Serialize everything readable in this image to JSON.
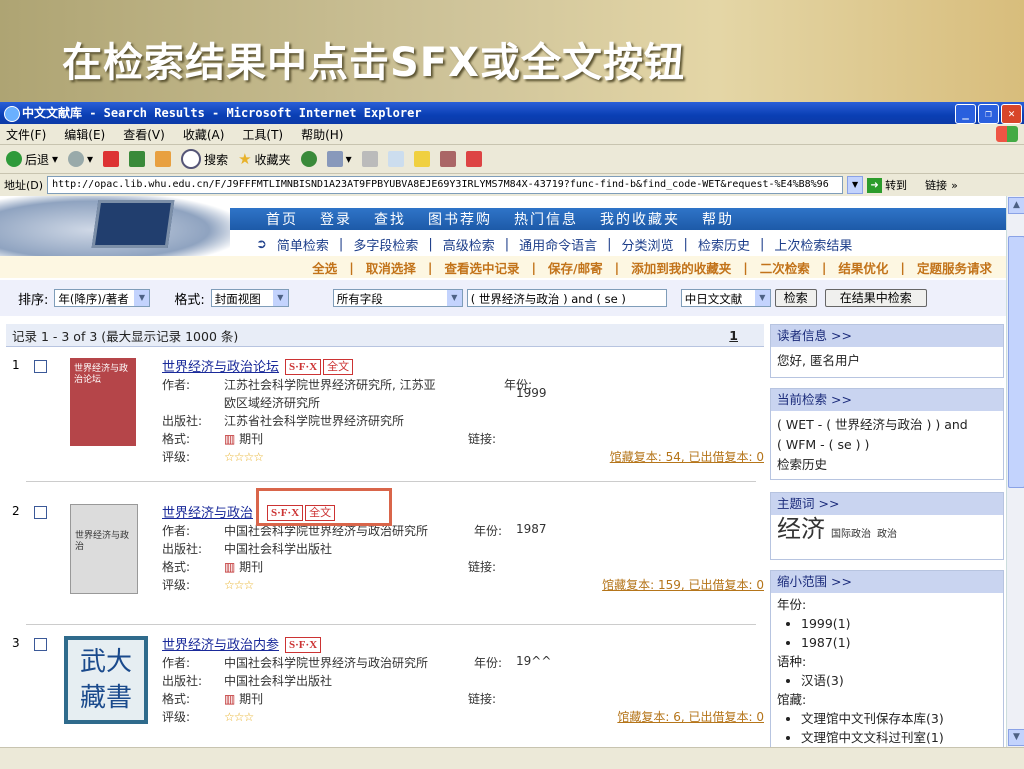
{
  "slide": {
    "title": "在检索结果中点击SFX或全文按钮"
  },
  "window": {
    "title": "中文文献库 - Search Results - Microsoft Internet Explorer",
    "menu": [
      "文件(F)",
      "编辑(E)",
      "查看(V)",
      "收藏(A)",
      "工具(T)",
      "帮助(H)"
    ],
    "toolbar": {
      "back": "后退",
      "search": "搜索",
      "favorites": "收藏夹"
    },
    "address_label": "地址(D)",
    "address": "http://opac.lib.whu.edu.cn/F/J9FFFMTLIMNBISND1A23AT9FPBYUBVA8EJE69Y3IRLYMS7M84X-43719?func-find-b&find_code-WET&request-%E4%B8%96",
    "go": "转到",
    "links": "链接"
  },
  "nav": {
    "top": [
      "首页",
      "登录",
      "查找",
      "图书荐购",
      "热门信息",
      "我的收藏夹",
      "帮助"
    ],
    "sub": [
      "简单检索",
      "多字段检索",
      "高级检索",
      "通用命令语言",
      "分类浏览",
      "检索历史",
      "上次检索结果"
    ]
  },
  "actions": [
    "全选",
    "取消选择",
    "查看选中记录",
    "保存/邮寄",
    "添加到我的收藏夹",
    "二次检索",
    "结果优化",
    "定题服务请求"
  ],
  "search": {
    "sort_label": "排序:",
    "sort_value": "年(降序)/著者",
    "format_label": "格式:",
    "format_value": "封面视图",
    "field_value": "所有字段",
    "query_value": "( 世界经济与政治 ) and ( se )",
    "db_value": "中日文文献",
    "search_btn": "检索",
    "refine_btn": "在结果中检索"
  },
  "results": {
    "header": "记录 1 - 3 of 3 (最大显示记录 1000 条)",
    "page": "1",
    "labels": {
      "author": "作者:",
      "year": "年份:",
      "publisher": "出版社:",
      "format": "格式:",
      "link": "链接:",
      "rating": "评级:"
    },
    "sfx": "S·F·X",
    "fulltext": "全文",
    "records": [
      {
        "num": "1",
        "title": "世界经济与政治论坛",
        "author": "江苏社会科学院世界经济研究所, 江苏亚",
        "author2": "欧区域经济研究所",
        "year": "1999",
        "publisher": "江苏省社会科学院世界经济研究所",
        "format": "期刊",
        "rating": "☆☆☆☆",
        "holdings": "馆藏复本: 54, 已出借复本: 0",
        "cover_text": "世界经济与政治论坛"
      },
      {
        "num": "2",
        "title": "世界经济与政治",
        "author": "中国社会科学院世界经济与政治研究所",
        "year": "1987",
        "publisher": "中国社会科学出版社",
        "format": "期刊",
        "rating": "☆☆☆",
        "holdings": "馆藏复本: 159, 已出借复本: 0",
        "cover_text": "世界经济与政治"
      },
      {
        "num": "3",
        "title": "世界经济与政治内参",
        "author": "中国社会科学院世界经济与政治研究所",
        "year": "19^^",
        "publisher": "中国社会科学出版社",
        "format": "期刊",
        "rating": "☆☆☆",
        "holdings": "馆藏复本: 6, 已出借复本: 0",
        "cover_text": "武大藏書"
      }
    ]
  },
  "sidebar": {
    "reader": {
      "title": "读者信息 >>",
      "text": "您好, 匿名用户"
    },
    "current": {
      "title": "当前检索 >>",
      "lines": [
        "( WET - ( 世界经济与政治 ) ) and",
        "( WFM - ( se ) )"
      ],
      "history": "检索历史"
    },
    "topics": {
      "title": "主题词 >>",
      "main": "经济",
      "extra": [
        "国际政治",
        "政治"
      ]
    },
    "narrow": {
      "title": "缩小范围 >>",
      "year_label": "年份:",
      "years": [
        "1999(1)",
        "1987(1)"
      ],
      "lang_label": "语种:",
      "langs": [
        "汉语(3)"
      ],
      "lib_label": "馆藏:",
      "libs": [
        "文理馆中文刊保存本库(3)",
        "文理馆中文文科过刊室(1)"
      ]
    }
  }
}
